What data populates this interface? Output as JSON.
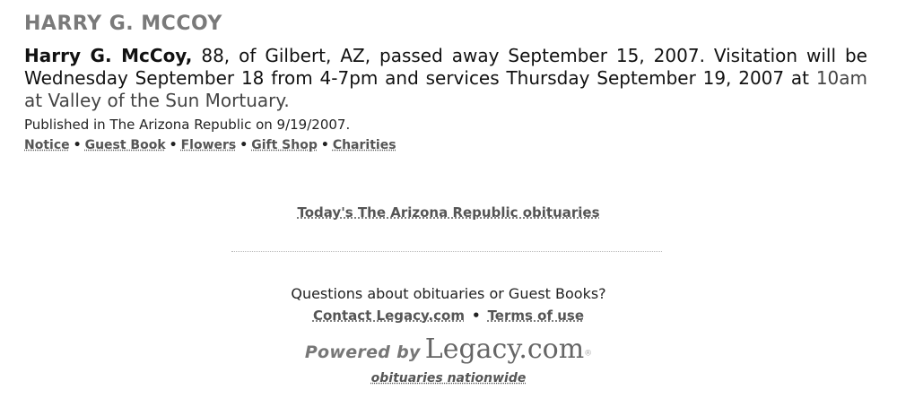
{
  "obituary": {
    "heading": "HARRY G. MCCOY",
    "name": "Harry G. McCoy,",
    "text": " 88, of Gilbert, AZ, passed away September 15, 2007. Visitation will be Wednesday September 18 from 4-7pm and services Thursday September 19, 2007 at ",
    "text_last": "10am at Valley of the Sun Mortuary.",
    "published": "Published in The Arizona Republic on 9/19/2007."
  },
  "links": [
    {
      "label": "Notice"
    },
    {
      "label": "Guest Book"
    },
    {
      "label": "Flowers"
    },
    {
      "label": "Gift Shop"
    },
    {
      "label": "Charities"
    }
  ],
  "link_separator": "•",
  "today_link": "Today's The Arizona Republic obituaries",
  "footer": {
    "question": "Questions about obituaries or Guest Books?",
    "contact_label": "Contact Legacy.com",
    "terms_label": "Terms of use",
    "separator": "•",
    "powered_by": "Powered by",
    "brand": "Legacy.com",
    "reg_mark": "®",
    "tagline": "obituaries nationwide"
  },
  "colors": {
    "heading": "#7a7a7a",
    "link": "#555555",
    "text": "#111111"
  }
}
